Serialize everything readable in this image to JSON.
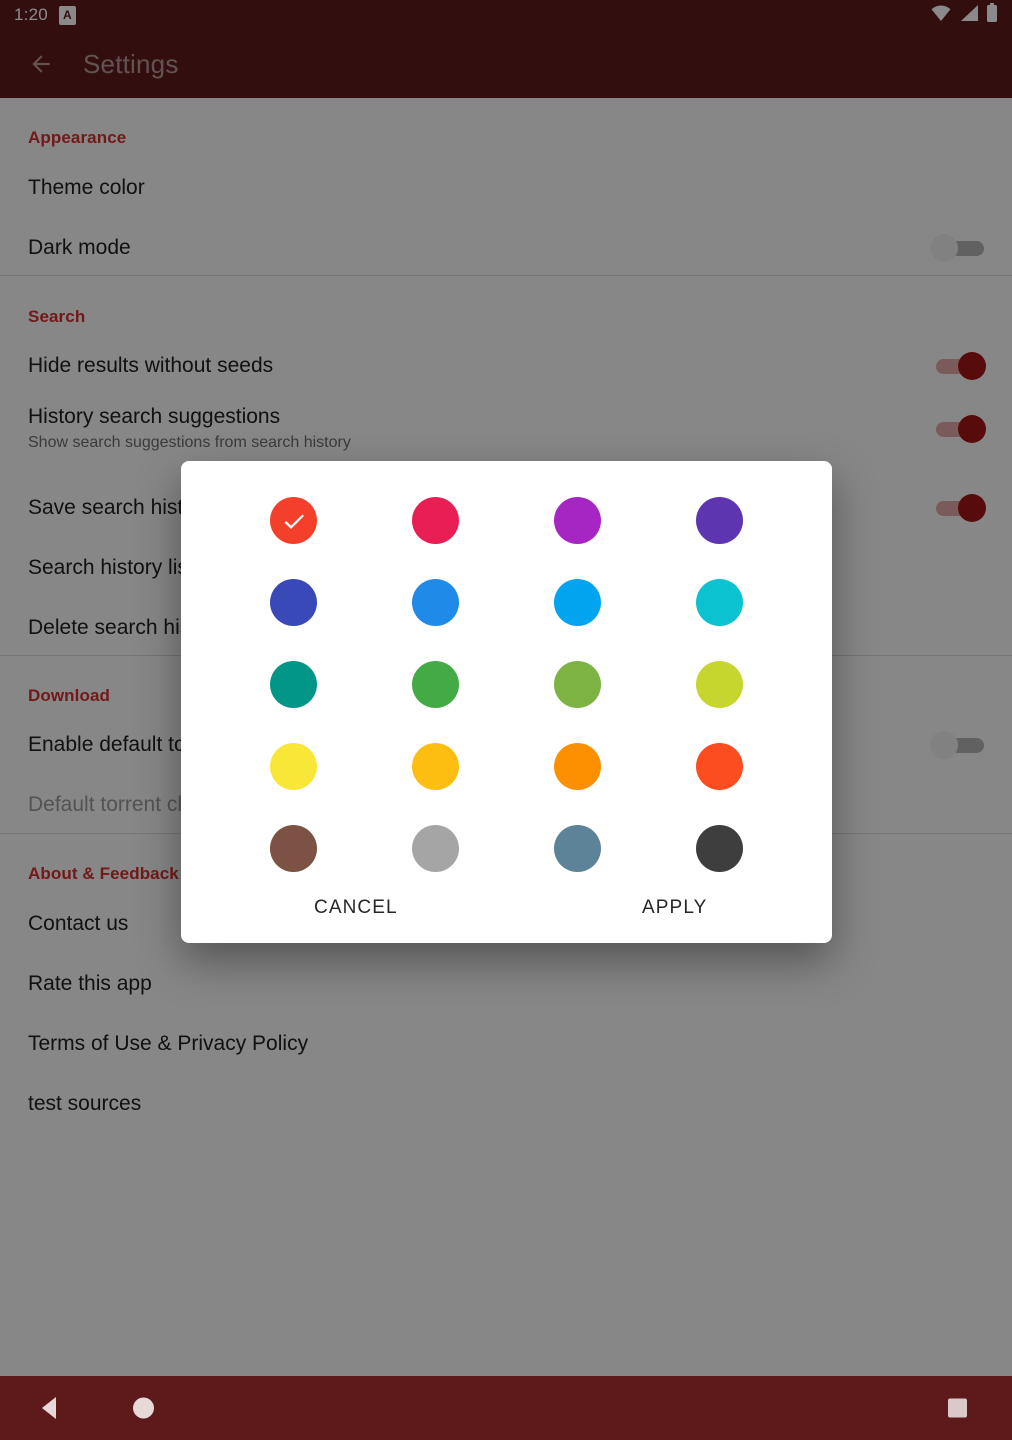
{
  "status_bar": {
    "time": "1:20",
    "chip_label": "A",
    "icons": [
      "wifi-icon",
      "cell-signal-icon",
      "battery-icon"
    ]
  },
  "app_bar": {
    "back_icon": "arrow-back-icon",
    "title": "Settings"
  },
  "settings": {
    "sections": [
      {
        "header": "Appearance",
        "items": [
          {
            "title": "Theme color",
            "subtitle": "",
            "control": "none"
          },
          {
            "title": "Dark mode",
            "subtitle": "",
            "control": "switch",
            "checked": false
          }
        ]
      },
      {
        "header": "Search",
        "items": [
          {
            "title": "Hide results without seeds",
            "subtitle": "",
            "control": "switch",
            "checked": true
          },
          {
            "title": "History search suggestions",
            "subtitle": "Show search suggestions from search history",
            "control": "switch",
            "checked": true
          },
          {
            "title": "Save search history",
            "subtitle": "",
            "control": "switch",
            "checked": true
          },
          {
            "title": "Search history list",
            "subtitle": "",
            "control": "none"
          },
          {
            "title": "Delete search history",
            "subtitle": "",
            "control": "none"
          }
        ]
      },
      {
        "header": "Download",
        "items": [
          {
            "title": "Enable default torrent client",
            "subtitle": "",
            "control": "switch",
            "checked": false
          },
          {
            "title": "Default torrent client",
            "subtitle": "",
            "control": "none",
            "disabled": true
          }
        ]
      },
      {
        "header": "About & Feedback",
        "items": [
          {
            "title": "Contact us",
            "subtitle": "",
            "control": "none"
          },
          {
            "title": "Rate this app",
            "subtitle": "",
            "control": "none"
          },
          {
            "title": "Terms of Use & Privacy Policy",
            "subtitle": "",
            "control": "none"
          },
          {
            "title": "test sources",
            "subtitle": "",
            "control": "none"
          }
        ]
      }
    ]
  },
  "dialog": {
    "name": "theme-color-picker-dialog",
    "selected_index": 0,
    "check_icon": "check-icon",
    "colors": [
      "#f4402a",
      "#e91e54",
      "#a626c4",
      "#5e35b1",
      "#3949b7",
      "#1f8ae8",
      "#03a4ef",
      "#0ac2d0",
      "#019688",
      "#43aa46",
      "#7cb342",
      "#c6d62e",
      "#f9e738",
      "#fdbe11",
      "#fd9000",
      "#fb4d20",
      "#7b5243",
      "#a5a5a5",
      "#5c8398",
      "#3e3e3e"
    ],
    "cancel_label": "CANCEL",
    "apply_label": "APPLY"
  },
  "nav_bar": {
    "back_icon": "nav-back-icon",
    "home_icon": "nav-home-icon",
    "recents_icon": "nav-recents-icon"
  },
  "theme": {
    "primary": "#5e1a1a",
    "section_header_color": "#d32f2f",
    "switch_on_color": "#a31515"
  }
}
